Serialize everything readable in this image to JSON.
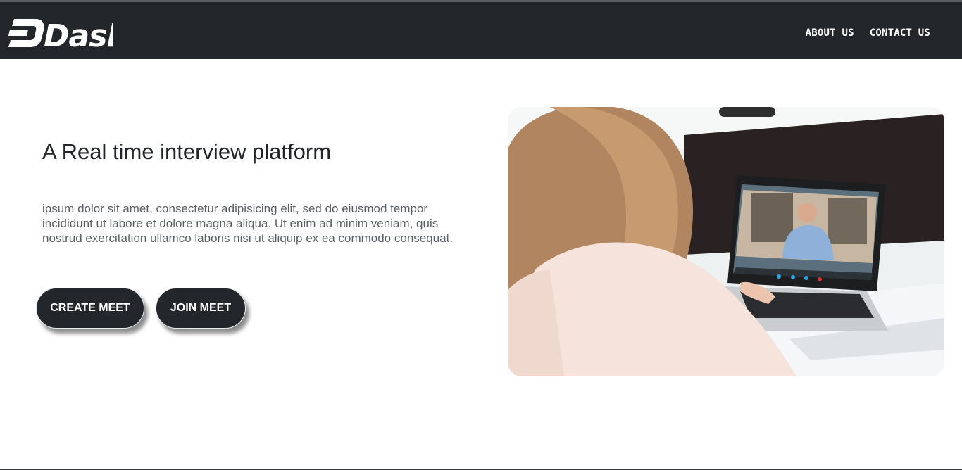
{
  "header": {
    "logo_text": "Dash",
    "nav": [
      {
        "label": "ABOUT US"
      },
      {
        "label": "CONTACT US"
      }
    ]
  },
  "hero": {
    "title": "A Real time interview platform",
    "description": "ipsum dolor sit amet, consectetur adipisicing elit, sed do eiusmod tempor incididunt ut labore et dolore magna aliqua. Ut enim ad minim veniam, quis nostrud exercitation ullamco laboris nisi ut aliquip ex ea commodo consequat.",
    "buttons": {
      "create": "CREATE MEET",
      "join": "JOIN MEET"
    },
    "image_subject": "woman-on-video-call-photo"
  },
  "colors": {
    "navbar": "#23272b",
    "button": "#23272b",
    "text": "#212529",
    "muted_text": "#5c5f63"
  }
}
